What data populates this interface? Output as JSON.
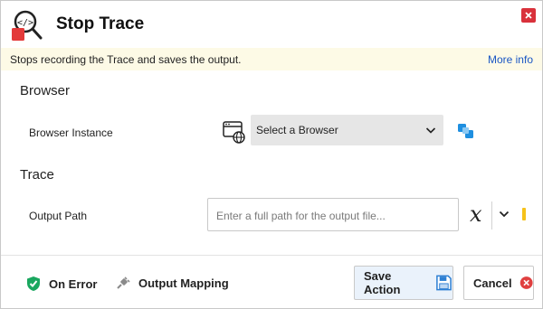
{
  "window": {
    "title": "Stop Trace"
  },
  "info": {
    "description": "Stops recording the Trace and saves the output.",
    "more_info": "More info"
  },
  "sections": {
    "browser": "Browser",
    "trace": "Trace"
  },
  "fields": {
    "browser_instance": {
      "label": "Browser Instance",
      "value": "Select a Browser"
    },
    "output_path": {
      "label": "Output Path",
      "placeholder": "Enter a full path for the output file..."
    }
  },
  "footer": {
    "on_error": "On Error",
    "output_mapping": "Output Mapping",
    "save_action": "Save Action",
    "cancel": "Cancel"
  },
  "colors": {
    "accent": "#1a56c4",
    "close": "#d9313b",
    "info_bg": "#fdfae6",
    "variable_marker": "#f6c21a"
  }
}
